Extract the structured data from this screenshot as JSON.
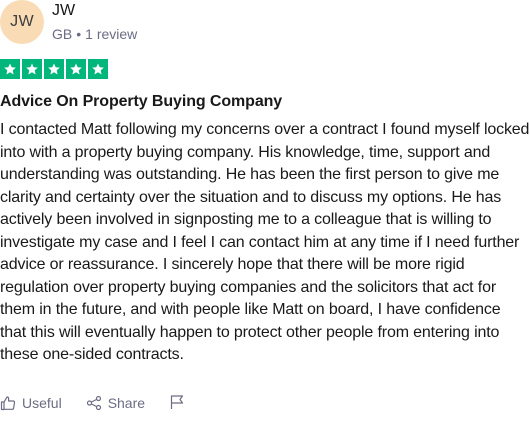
{
  "reviewer": {
    "initials": "JW",
    "name": "JW",
    "country": "GB",
    "separator": "•",
    "review_count": "1 review"
  },
  "rating": {
    "stars": 5,
    "max": 5,
    "color": "#00b67a"
  },
  "review": {
    "title": "Advice On Property Buying Company",
    "body": "I contacted Matt following my concerns over a contract I found myself locked into with a property buying company. His knowledge, time, support and understanding was outstanding. He has been the first person to give me clarity and certainty over the situation and to discuss my options. He has actively been involved in signposting me to a colleague that is willing to investigate my case and I feel I can contact him at any time if I need further advice or reassurance. I sincerely hope that there will be more rigid regulation over property buying companies and the solicitors that act for them in the future, and with people like Matt on board, I have confidence that this will eventually happen to protect other people from entering into these one-sided contracts."
  },
  "actions": {
    "useful_label": "Useful",
    "share_label": "Share",
    "useful_icon": "thumbs-up-icon",
    "share_icon": "share-icon",
    "flag_icon": "flag-icon"
  },
  "colors": {
    "avatar_bg": "#f9dcb5",
    "muted_text": "#6c6c85",
    "text": "#191919"
  }
}
